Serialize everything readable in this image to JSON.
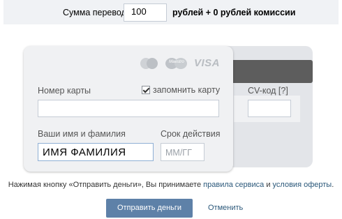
{
  "amount": {
    "label": "Сумма перевода:",
    "value": "100",
    "suffix": "рублей + 0 рублей комиссии"
  },
  "card": {
    "logos": [
      "mastercard-icon",
      "maestro-icon",
      "visa-icon"
    ],
    "maestro_text": "Maestro",
    "visa_text": "VISA",
    "number_label": "Номер карты",
    "remember_label": "запомнить карту",
    "remember_checked": true,
    "name_label": "Ваши имя и фамилия",
    "name_value": "ИМЯ ФАМИЛИЯ",
    "expiry_label": "Срок действия",
    "expiry_placeholder": "ММ/ГГ",
    "cv_label": "CV-код [?]"
  },
  "terms": {
    "prefix": "Нажимая кнопку «Отправить деньги», Вы принимаете ",
    "rules_link": "правила сервиса",
    "and": " и ",
    "offer_link": "условия оферты",
    "suffix": "."
  },
  "actions": {
    "send_label": "Отправить деньги",
    "cancel_label": "Отменить"
  },
  "colors": {
    "accent": "#5e81a8",
    "link": "#2b587a",
    "card_bg": "#f0f1f3",
    "stripe": "#5d5d5d"
  }
}
